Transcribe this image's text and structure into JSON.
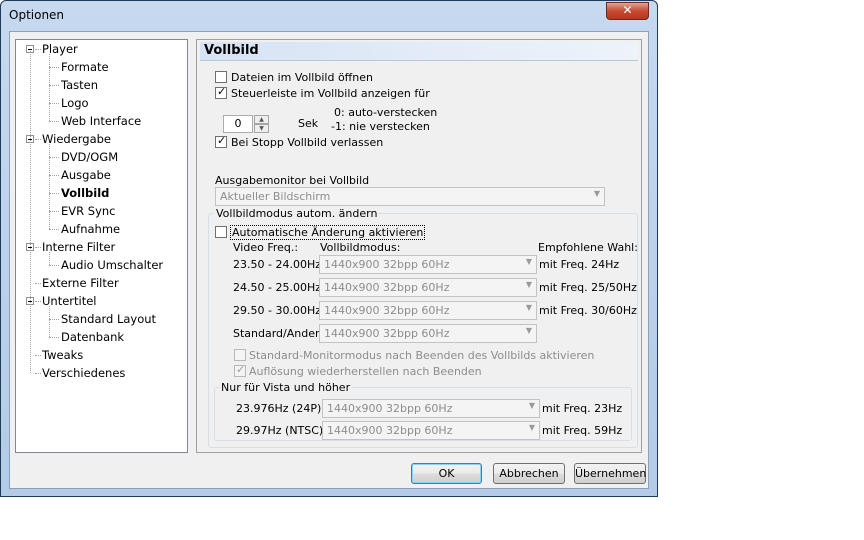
{
  "window": {
    "title": "Optionen",
    "close_label": "✕"
  },
  "tree": [
    {
      "label": "Player",
      "level": 0
    },
    {
      "label": "Formate",
      "level": 1
    },
    {
      "label": "Tasten",
      "level": 1
    },
    {
      "label": "Logo",
      "level": 1
    },
    {
      "label": "Web Interface",
      "level": 1
    },
    {
      "label": "Wiedergabe",
      "level": 0
    },
    {
      "label": "DVD/OGM",
      "level": 1
    },
    {
      "label": "Ausgabe",
      "level": 1
    },
    {
      "label": "Vollbild",
      "level": 1,
      "selected": true
    },
    {
      "label": "EVR Sync",
      "level": 1
    },
    {
      "label": "Aufnahme",
      "level": 1
    },
    {
      "label": "Interne Filter",
      "level": 0
    },
    {
      "label": "Audio Umschalter",
      "level": 1
    },
    {
      "label": "Externe Filter",
      "level": 0
    },
    {
      "label": "Untertitel",
      "level": 0
    },
    {
      "label": "Standard Layout",
      "level": 1
    },
    {
      "label": "Datenbank",
      "level": 1
    },
    {
      "label": "Tweaks",
      "level": 0
    },
    {
      "label": "Verschiedenes",
      "level": 0
    }
  ],
  "panel": {
    "title": "Vollbild",
    "open_fullscreen": "Dateien im Vollbild öffnen",
    "show_controls": "Steuerleiste im Vollbild anzeigen für",
    "spin_value": "0",
    "spin_unit": "Sek",
    "hint1": "0: auto-verstecken",
    "hint2": "-1: nie verstecken",
    "leave_on_stop": "Bei Stopp Vollbild verlassen",
    "monitor_label": "Ausgabemonitor bei Vollbild",
    "monitor_value": "Aktueller Bildschirm",
    "autochange_group": "Vollbildmodus autom. ändern",
    "autochange_enable": "Automatische Änderung aktivieren",
    "col_freq": "Video Freq.:",
    "col_mode": "Vollbildmodus:",
    "col_recommended": "Empfohlene Wahl:",
    "rows": [
      {
        "freq": "23.50 - 24.00Hz",
        "mode": "1440x900 32bpp 60Hz",
        "rec": "mit Freq. 24Hz"
      },
      {
        "freq": "24.50 - 25.00Hz",
        "mode": "1440x900 32bpp 60Hz",
        "rec": "mit Freq. 25/50Hz"
      },
      {
        "freq": "29.50 - 30.00Hz",
        "mode": "1440x900 32bpp 60Hz",
        "rec": "mit Freq. 30/60Hz"
      },
      {
        "freq": "Standard/Andere",
        "mode": "1440x900 32bpp 60Hz",
        "rec": ""
      }
    ],
    "std_monitor": "Standard-Monitormodus nach Beenden des Vollbilds aktivieren",
    "restore_res": "Auflösung wiederherstellen nach Beenden",
    "vista_group": "Nur für Vista und höher",
    "vista_rows": [
      {
        "freq": "23.976Hz (24P)",
        "mode": "1440x900 32bpp 60Hz",
        "rec": "mit Freq. 23Hz"
      },
      {
        "freq": "29.97Hz (NTSC)",
        "mode": "1440x900 32bpp 60Hz",
        "rec": "mit Freq. 59Hz"
      }
    ]
  },
  "buttons": {
    "ok": "OK",
    "cancel": "Abbrechen",
    "apply": "Übernehmen"
  }
}
